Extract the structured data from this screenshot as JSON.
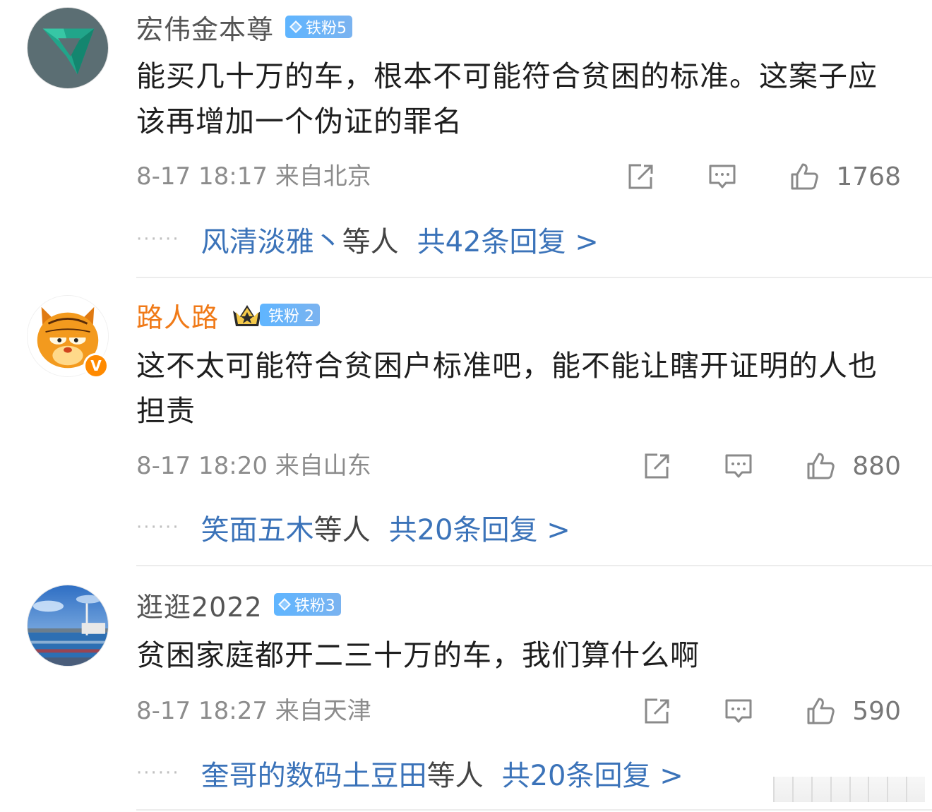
{
  "comments": [
    {
      "username": "宏伟金本尊",
      "badge": "铁粉5",
      "text": "能买几十万的车，根本不可能符合贫困的标准。这案子应该再增加一个伪证的罪名",
      "time": "8-17 18:17",
      "location": "来自北京",
      "likes": "1768",
      "reply_names": "风清淡雅丶",
      "reply_suffix": "等人",
      "reply_total": "共42条回复 >",
      "dots": "······"
    },
    {
      "username": "路人路",
      "badge": "铁粉 2",
      "verified": "V",
      "text": "这不太可能符合贫困户标准吧，能不能让瞎开证明的人也担责",
      "time": "8-17 18:20",
      "location": "来自山东",
      "likes": "880",
      "reply_names": "笑面五木",
      "reply_suffix": "等人",
      "reply_total": "共20条回复 >",
      "dots": "······"
    },
    {
      "username": "逛逛2022",
      "badge": "铁粉3",
      "text": "贫困家庭都开二三十万的车，我们算什么啊",
      "time": "8-17 18:27",
      "location": "来自天津",
      "likes": "590",
      "reply_names": "奎哥的数码土豆田",
      "reply_suffix": "等人",
      "reply_total": "共20条回复 >",
      "dots": "······"
    }
  ],
  "colors": {
    "username_default": "#555555",
    "username_vip": "#f07a18",
    "reply_link": "#3b73b9",
    "meta": "#8c8c8c",
    "badge": "#6ab4fb"
  },
  "icons": [
    "share-icon",
    "comment-icon",
    "like-icon",
    "diamond-icon",
    "crown-icon"
  ]
}
